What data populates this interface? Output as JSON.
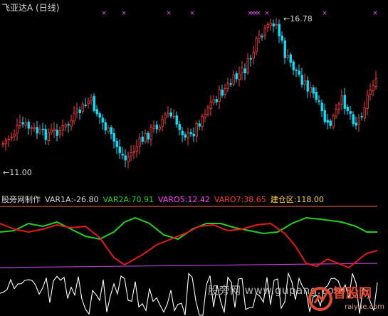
{
  "header": {
    "title": "飞亚达A (日线)",
    "high_label": "16.78",
    "low_label": "11.00"
  },
  "indicator": {
    "name": "股旁网制作",
    "var1a": "VAR1A:-26.80",
    "var2a": "VAR2A:70.91",
    "varo5": "VARO5:12.42",
    "varo7": "VARO7:38.65",
    "jiancang": "建仓区:118.00"
  },
  "watermark": {
    "site_text": "股旁网  www.gupang.com",
    "brand": "智股网",
    "domain": "raiyue.com"
  },
  "colors": {
    "up": "#ff3a3a",
    "down": "#00e4ff",
    "magenta": "#ff40ff",
    "green": "#1ed21e",
    "red_line": "#e81818",
    "white_line": "#ffffff",
    "purple": "#b040d0",
    "orange": "#ff6a3a"
  }
}
